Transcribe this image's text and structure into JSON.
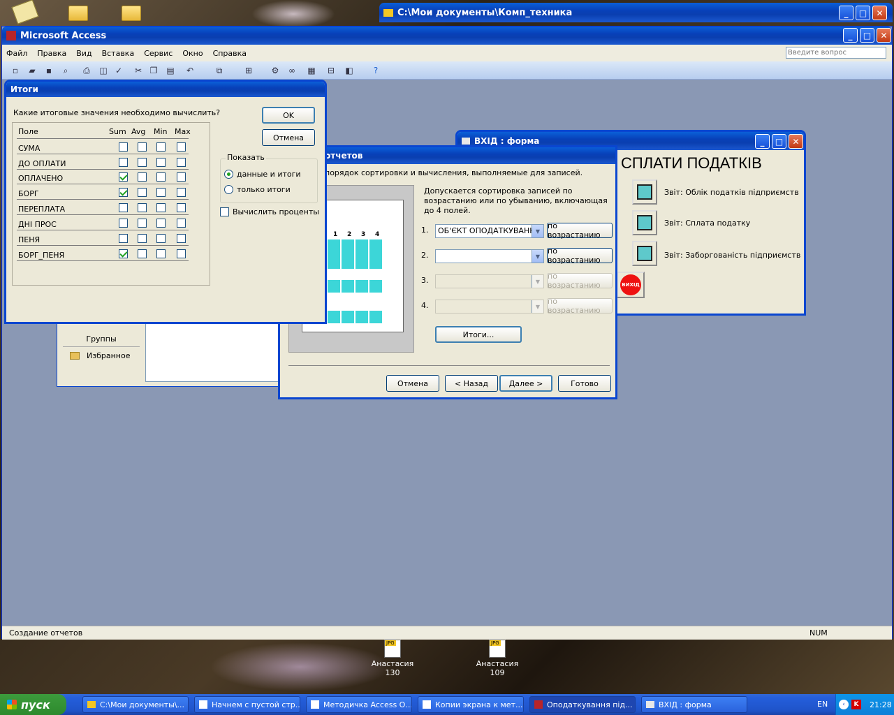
{
  "desktop": {
    "icons": [
      {
        "name": "Анастасия",
        "number": "130",
        "badge": "JPG"
      },
      {
        "name": "Анастасия",
        "number": "109",
        "badge": "JPG"
      }
    ]
  },
  "explorer_window": {
    "title": "C:\\Мои документы\\Комп_техника"
  },
  "access": {
    "title": "Microsoft Access",
    "menu": [
      "Файл",
      "Правка",
      "Вид",
      "Вставка",
      "Сервис",
      "Окно",
      "Справка"
    ],
    "help_placeholder": "Введите вопрос",
    "status": "Создание отчетов",
    "status_num": "NUM"
  },
  "db_window": {
    "groups_label": "Группы",
    "favorites_label": "Избранное"
  },
  "form_window": {
    "title": "ВХІД : форма",
    "heading": "СПЛАТИ ПОДАТКІВ",
    "items": [
      "Звіт: Облік податків підприємств",
      "Звіт: Сплата податку",
      "Звіт: Заборгованість підприємств"
    ],
    "exit_label": "ВИХІД"
  },
  "report_wizard": {
    "title": "отчетов",
    "intro": "порядок сортировки и вычисления, выполняемые для записей.",
    "note": "Допускается сортировка записей по возрастанию или по убыванию, включающая до 4 полей.",
    "sort_rows": [
      {
        "num": "1.",
        "field": "ОБ'ЄКТ ОПОДАТКУВАННЯ",
        "order": "по возрастанию",
        "enabled": true
      },
      {
        "num": "2.",
        "field": "",
        "order": "по возрастанию",
        "enabled": true
      },
      {
        "num": "3.",
        "field": "",
        "order": "по возрастанию",
        "enabled": false
      },
      {
        "num": "4.",
        "field": "",
        "order": "по возрастанию",
        "enabled": false
      }
    ],
    "preview_cols": [
      "1",
      "2",
      "3",
      "4"
    ],
    "totals_button": "Итоги...",
    "buttons": {
      "cancel": "Отмена",
      "back": "< Назад",
      "next": "Далее >",
      "finish": "Готово"
    }
  },
  "totals_dialog": {
    "title": "Итоги",
    "question": "Какие итоговые значения необходимо вычислить?",
    "ok": "OK",
    "cancel": "Отмена",
    "headers": {
      "field": "Поле",
      "sum": "Sum",
      "avg": "Avg",
      "min": "Min",
      "max": "Max"
    },
    "rows": [
      {
        "field": "СУМА",
        "sum": false,
        "avg": false,
        "min": false,
        "max": false
      },
      {
        "field": "ДО ОПЛАТИ",
        "sum": false,
        "avg": false,
        "min": false,
        "max": false
      },
      {
        "field": "ОПЛАЧЕНО",
        "sum": true,
        "avg": false,
        "min": false,
        "max": false
      },
      {
        "field": "БОРГ",
        "sum": true,
        "avg": false,
        "min": false,
        "max": false
      },
      {
        "field": "ПЕРЕПЛАТА",
        "sum": false,
        "avg": false,
        "min": false,
        "max": false
      },
      {
        "field": "ДНІ ПРОС",
        "sum": false,
        "avg": false,
        "min": false,
        "max": false
      },
      {
        "field": "ПЕНЯ",
        "sum": false,
        "avg": false,
        "min": false,
        "max": false
      },
      {
        "field": "БОРГ_ПЕНЯ",
        "sum": true,
        "avg": false,
        "min": false,
        "max": false
      }
    ],
    "show_label": "Показать",
    "show_options": [
      {
        "label": "данные и итоги",
        "selected": true
      },
      {
        "label": "только итоги",
        "selected": false
      }
    ],
    "percent_label": "Вычислить проценты",
    "percent_checked": false
  },
  "taskbar": {
    "start": "пуск",
    "tasks": [
      "C:\\Мои документы\\...",
      "Начнем с пустой стр...",
      "Методичка Access О...",
      "Копии экрана к мет...",
      "Оподаткування під...",
      "ВХІД : форма"
    ],
    "lang": "EN",
    "time": "21:28"
  }
}
